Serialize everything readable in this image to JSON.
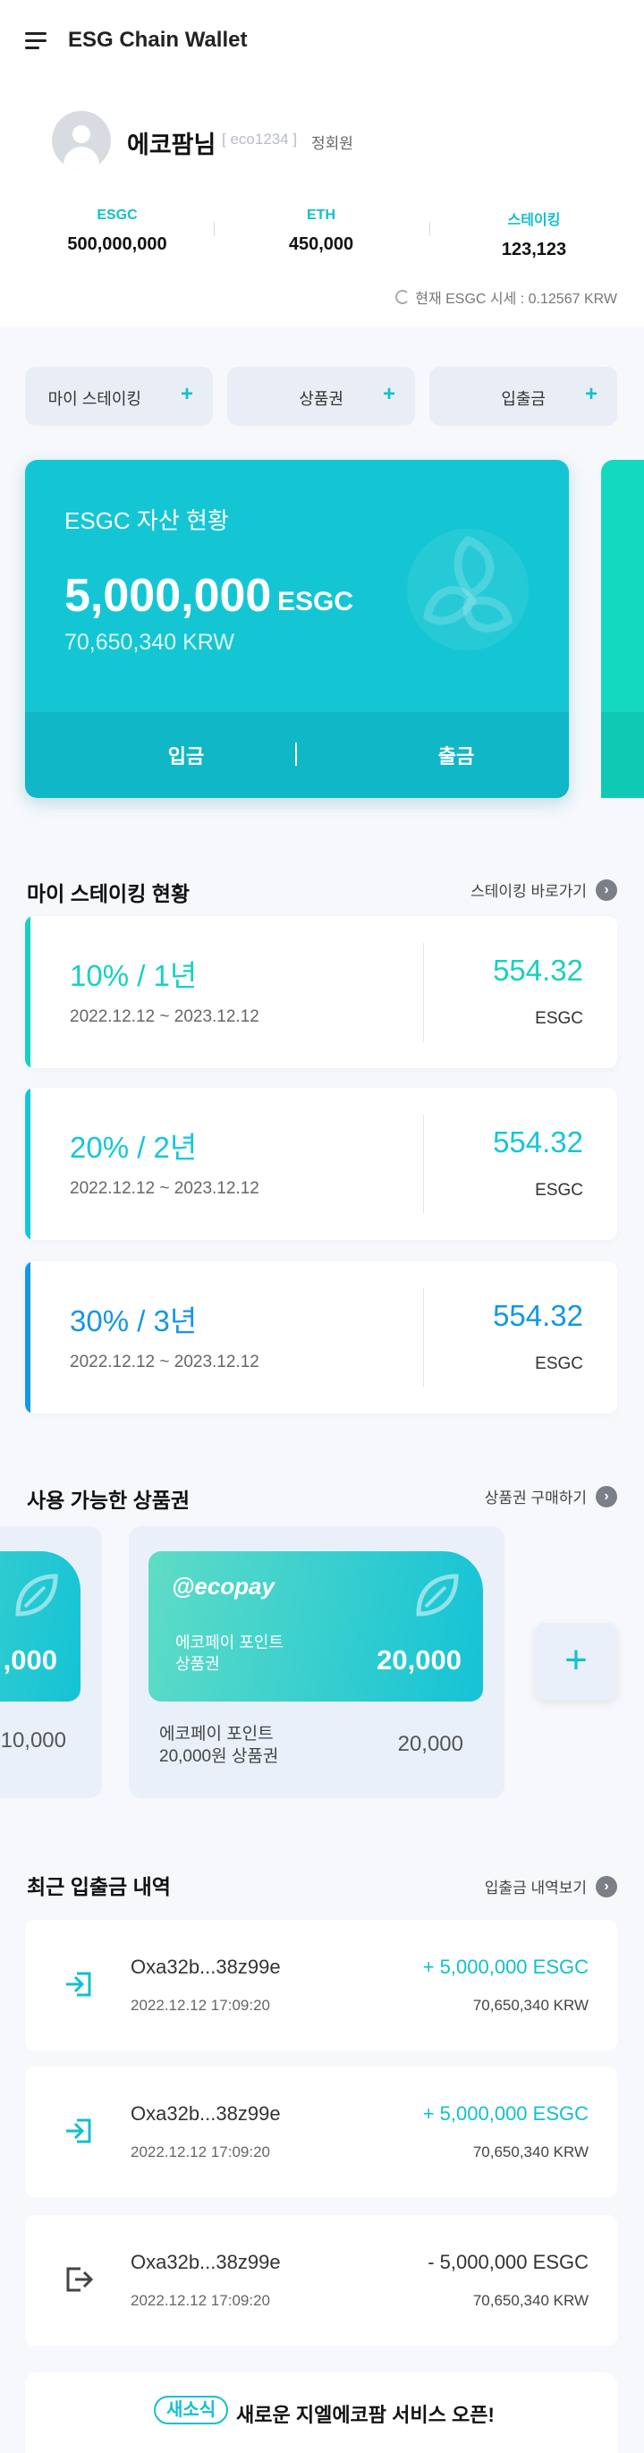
{
  "app": {
    "title": "ESG Chain Wallet"
  },
  "user": {
    "name": "에코팜님",
    "id": "eco1234",
    "grade": "정회원"
  },
  "balances": [
    {
      "label": "ESGC",
      "value": "500,000,000"
    },
    {
      "label": "ETH",
      "value": "450,000"
    },
    {
      "label": "스테이킹",
      "value": "123,123"
    }
  ],
  "rate": {
    "text": "현재 ESGC 시세 : 0.12567 KRW"
  },
  "quick_actions": [
    {
      "label": "마이 스테이킹",
      "icon": "plus-icon"
    },
    {
      "label": "상품권",
      "icon": "plus-icon"
    },
    {
      "label": "입출금",
      "icon": "plus-icon"
    }
  ],
  "asset": {
    "title": "ESGC 자산 현황",
    "amount": "5,000,000",
    "unit": "ESGC",
    "krw": "70,650,340 KRW",
    "deposit_label": "입금",
    "withdraw_label": "출금"
  },
  "staking": {
    "title": "마이 스테이킹 현황",
    "link": "스테이킹 바로가기",
    "items": [
      {
        "plan": "10% / 1년",
        "period": "2022.12.12 ~ 2023.12.12",
        "amount": "554.32",
        "currency": "ESGC",
        "color": "#17d1bf"
      },
      {
        "plan": "20% / 2년",
        "period": "2022.12.12 ~ 2023.12.12",
        "amount": "554.32",
        "currency": "ESGC",
        "color": "#14c6dc"
      },
      {
        "plan": "30% / 3년",
        "period": "2022.12.12 ~ 2023.12.12",
        "amount": "554.32",
        "currency": "ESGC",
        "color": "#1596e6"
      }
    ]
  },
  "vouchers": {
    "title": "사용 가능한 상품권",
    "link": "상품권 구매하기",
    "partial": {
      "card_amount": ",000",
      "price": "10,000"
    },
    "main": {
      "brand": "ecopay",
      "card_name": "에코페이 포인트\n상품권",
      "card_amount": "20,000",
      "desc": "에코페이 포인트\n20,000원 상품권",
      "price": "20,000"
    },
    "add_label": "+"
  },
  "transactions": {
    "title": "최근 입출금 내역",
    "link": "입출금 내역보기",
    "items": [
      {
        "hash": "Oxa32b...38z99e",
        "date": "2022.12.12 17:09:20",
        "amount": "+ 5,000,000 ESGC",
        "krw": "70,650,340 KRW",
        "type": "in",
        "color": "#12bfcf"
      },
      {
        "hash": "Oxa32b...38z99e",
        "date": "2022.12.12 17:09:20",
        "amount": "+ 5,000,000 ESGC",
        "krw": "70,650,340 KRW",
        "type": "in",
        "color": "#12bfcf"
      },
      {
        "hash": "Oxa32b...38z99e",
        "date": "2022.12.12 17:09:20",
        "amount": "- 5,000,000 ESGC",
        "krw": "70,650,340 KRW",
        "type": "out",
        "color": "#333333"
      }
    ]
  },
  "notice": {
    "badge": "새소식",
    "text": "새로운 지엘에코팜 서비스 오픈!"
  }
}
